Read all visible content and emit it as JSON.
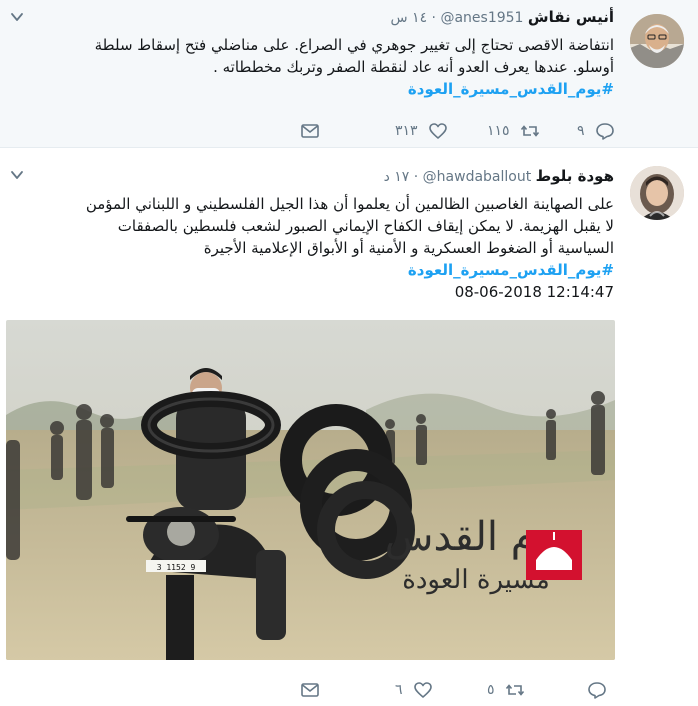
{
  "colors": {
    "accent": "#1da1f2",
    "muted": "#657786",
    "text": "#14171a",
    "highlight_bg": "#f5f8fa",
    "divider": "#e6ecf0"
  },
  "tweets": [
    {
      "author_name": "أنيس نقاش",
      "handle": "@anes1951",
      "dot": "·",
      "time": "١٤ س",
      "text_line1": "انتفاضة الاقصى تحتاج إلى تغيير جوهري في الصراع. على مناضلي فتح إسقاط سلطة",
      "text_line2": "أوسلو. عندها يعرف العدو أنه عاد لنقطة الصفر وتربك مخططاته .",
      "hashtag": "#يوم_القدس_مسيرة_العودة",
      "reply_count": "٩",
      "retweet_count": "١١٥",
      "like_count": "٣١٣",
      "icons": [
        "chevron-down-icon",
        "reply-icon",
        "retweet-icon",
        "like-icon",
        "message-icon"
      ]
    },
    {
      "author_name": "هودة بلوط",
      "handle": "@hawdaballout",
      "dot": "·",
      "time": "١٧ د",
      "text_line1": "على الصهاينة الغاصبين الظالمين أن يعلموا أن هذا الجيل الفلسطيني و اللبناني المؤمن",
      "text_line2": "لا يقبل الهزيمة. لا يمكن إيقاف الكفاح الإيماني الصبور لشعب فلسطين بالصفقات",
      "text_line3": "السياسية أو الضغوط العسكرية و الأمنية أو الأبواق الإعلامية الأجيرة",
      "hashtag": "#يوم_القدس_مسيرة_العودة",
      "timestamp": "08-06-2018 12:14:47",
      "media": {
        "title_line1": "يوم القدس",
        "title_line2": "مسيرة العودة",
        "plate": "3 1152 9"
      },
      "reply_count": "",
      "retweet_count": "٥",
      "like_count": "٦",
      "icons": [
        "chevron-down-icon",
        "reply-icon",
        "retweet-icon",
        "like-icon",
        "message-icon"
      ]
    }
  ]
}
